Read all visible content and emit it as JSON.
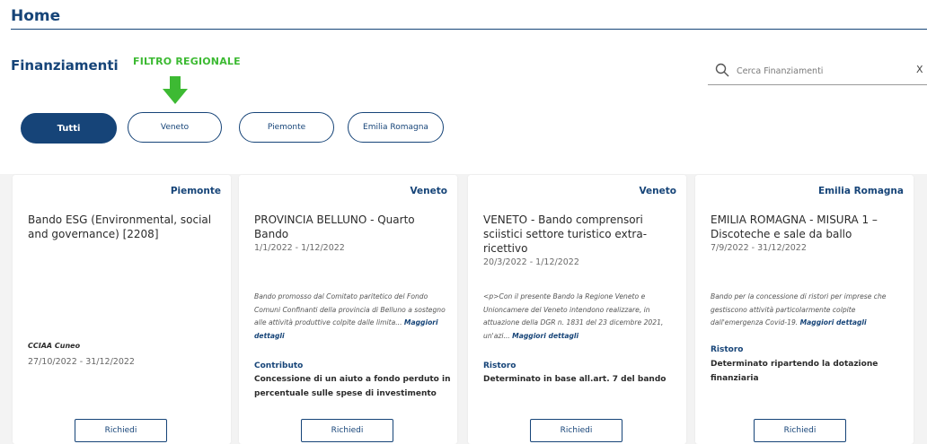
{
  "header": {
    "title": "Home"
  },
  "section": {
    "title": "Finanziamenti"
  },
  "annotation": {
    "label": "FILTRO REGIONALE",
    "color": "#3dba33"
  },
  "search": {
    "placeholder": "Cerca Finanziamenti",
    "clear_label": "X"
  },
  "filters": [
    {
      "label": "Tutti",
      "active": true
    },
    {
      "label": "Veneto",
      "active": false
    },
    {
      "label": "Piemonte",
      "active": false
    },
    {
      "label": "Emilia Romagna",
      "active": false
    }
  ],
  "cards": [
    {
      "region": "Piemonte",
      "title": "Bando ESG (Environmental, social and governance) [2208]",
      "organization": "CCIAA Cuneo",
      "dates": "27/10/2022 - 31/12/2022",
      "button": "Richiedi"
    },
    {
      "region": "Veneto",
      "title": "PROVINCIA BELLUNO - Quarto Bando",
      "dates": "1/1/2022 - 1/12/2022",
      "description": "Bando promosso dal Comitato paritetico del Fondo Comuni Confinanti della provincia di Belluno a sostegno alle attività produttive colpite dalle limita...",
      "more": "Maggiori dettagli",
      "type": "Contributo",
      "amount": "Concessione di un aiuto a fondo perduto in percentuale sulle spese di investimento",
      "button": "Richiedi"
    },
    {
      "region": "Veneto",
      "title": "VENETO - Bando comprensori sciistici settore turistico extra-ricettivo",
      "dates": "20/3/2022 - 1/12/2022",
      "description": "<p>Con il presente Bando la Regione Veneto e Unioncamere del Veneto intendono realizzare, in attuazione della DGR n. 1831 del 23 dicembre 2021, un'azi...",
      "more": "Maggiori dettagli",
      "type": "Ristoro",
      "amount": "Determinato in base all.art. 7 del bando",
      "button": "Richiedi"
    },
    {
      "region": "Emilia Romagna",
      "title": "EMILIA ROMAGNA - MISURA 1 – Discoteche e sale da ballo",
      "dates": "7/9/2022 - 31/12/2022",
      "description": "Bando per la concessione di ristori per imprese che gestiscono attività particolarmente colpite dall'emergenza Covid-19.",
      "more": "Maggiori dettagli",
      "type": "Ristoro",
      "amount": "Determinato ripartendo la dotazione finanziaria",
      "button": "Richiedi"
    }
  ],
  "colors": {
    "primary": "#164478",
    "accent": "#3dba33",
    "background": "#f3f3f3"
  }
}
